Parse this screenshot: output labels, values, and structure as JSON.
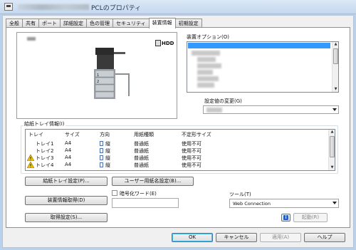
{
  "window": {
    "title": "PCLのプロパティ"
  },
  "tabs": [
    {
      "label": "全般",
      "active": false
    },
    {
      "label": "共有",
      "active": false
    },
    {
      "label": "ポート",
      "active": false
    },
    {
      "label": "詳細設定",
      "active": false
    },
    {
      "label": "色の管理",
      "active": false
    },
    {
      "label": "セキュリティ",
      "active": false
    },
    {
      "label": "装置情報",
      "active": true
    },
    {
      "label": "初期設定",
      "active": false
    }
  ],
  "device": {
    "hdd_label": "HDD"
  },
  "options": {
    "label": "装置オプション(O)",
    "value_change_label": "設定値の変更(G)"
  },
  "trays": {
    "group_label": "給紙トレイ情報(I)",
    "columns": [
      "トレイ",
      "サイズ",
      "方向",
      "用紙種類",
      "不定形サイズ"
    ],
    "rows": [
      {
        "tray": "トレイ1",
        "size": "A4",
        "orientation": "縦",
        "paper_type": "普通紙",
        "custom_size": "使用不可",
        "warning": false
      },
      {
        "tray": "トレイ2",
        "size": "A4",
        "orientation": "縦",
        "paper_type": "普通紙",
        "custom_size": "使用不可",
        "warning": false
      },
      {
        "tray": "トレイ3",
        "size": "A4",
        "orientation": "縦",
        "paper_type": "普通紙",
        "custom_size": "使用不可",
        "warning": true
      },
      {
        "tray": "トレイ4",
        "size": "A4",
        "orientation": "縦",
        "paper_type": "普通紙",
        "custom_size": "使用不可",
        "warning": true
      }
    ]
  },
  "buttons": {
    "tray_settings": "給紙トレイ設定(P)...",
    "user_paper_name": "ユーザー用紙名設定(B)...",
    "get_device_info": "装置情報取得(D)",
    "acquire_settings": "取得設定(S)...",
    "launch": "起動(R)",
    "ok": "OK",
    "cancel": "キャンセル",
    "apply": "適用(A)",
    "help": "ヘルプ"
  },
  "encryption": {
    "label": "暗号化ワード(E)"
  },
  "tool": {
    "label": "ツール(T)",
    "value": "Web Connection"
  },
  "colors": {
    "selection": "#3399ff",
    "warning": "#f5c400",
    "info": "#2360c7"
  }
}
